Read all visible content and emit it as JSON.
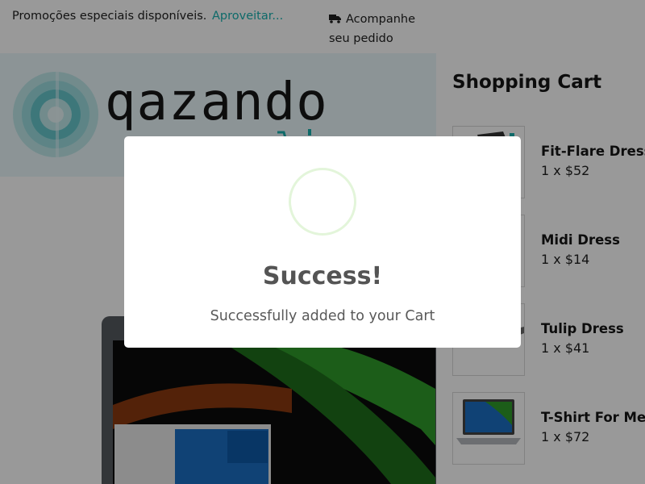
{
  "topbar": {
    "promo_text": "Promoções especiais disponíveis.",
    "promo_link": "Aproveitar...",
    "track_text": "Acompanhe seu pedido"
  },
  "header": {
    "logo_text": "qazando"
  },
  "cart": {
    "title": "Shopping Cart",
    "items": [
      {
        "name": "Fit-Flare Dress",
        "price": "1 x $52"
      },
      {
        "name": "Midi Dress",
        "price": "1 x $14"
      },
      {
        "name": "Tulip Dress",
        "price": "1 x $41"
      },
      {
        "name": "T-Shirt For Men",
        "price": "1 x $72"
      }
    ]
  },
  "modal": {
    "title": "Success!",
    "message": "Successfully added to your Cart"
  },
  "colors": {
    "accent": "#18b1b0",
    "success_ring": "#e3f5da"
  }
}
